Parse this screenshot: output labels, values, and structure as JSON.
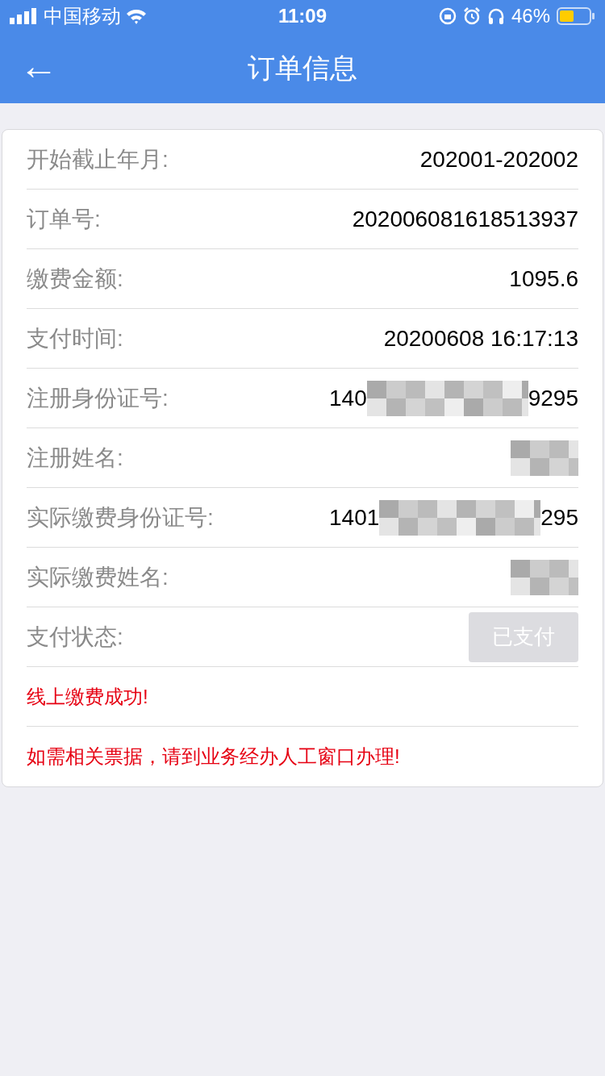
{
  "status_bar": {
    "carrier": "中国移动",
    "time": "11:09",
    "battery": "46%"
  },
  "nav": {
    "back": "←",
    "title": "订单信息"
  },
  "rows": [
    {
      "kind": "text",
      "label": "开始截止年月:",
      "value": "202001-202002"
    },
    {
      "kind": "text",
      "label": "订单号:",
      "value": "202006081618513937"
    },
    {
      "kind": "text",
      "label": "缴费金额:",
      "value": "1095.6"
    },
    {
      "kind": "text",
      "label": "支付时间:",
      "value": "20200608 16:17:13"
    },
    {
      "kind": "redacted",
      "label": "注册身份证号:",
      "prefix": "140",
      "suffix": "9295"
    },
    {
      "kind": "redacted",
      "label": "注册姓名:"
    },
    {
      "kind": "redacted",
      "label": "实际缴费身份证号:",
      "prefix": "1401",
      "suffix": "295"
    },
    {
      "kind": "redacted",
      "label": "实际缴费姓名:"
    },
    {
      "kind": "button",
      "label": "支付状态:",
      "value": "已支付",
      "disabled": true
    }
  ],
  "notes": [
    "线上缴费成功!",
    "如需相关票据，请到业务经办人工窗口办理!"
  ]
}
